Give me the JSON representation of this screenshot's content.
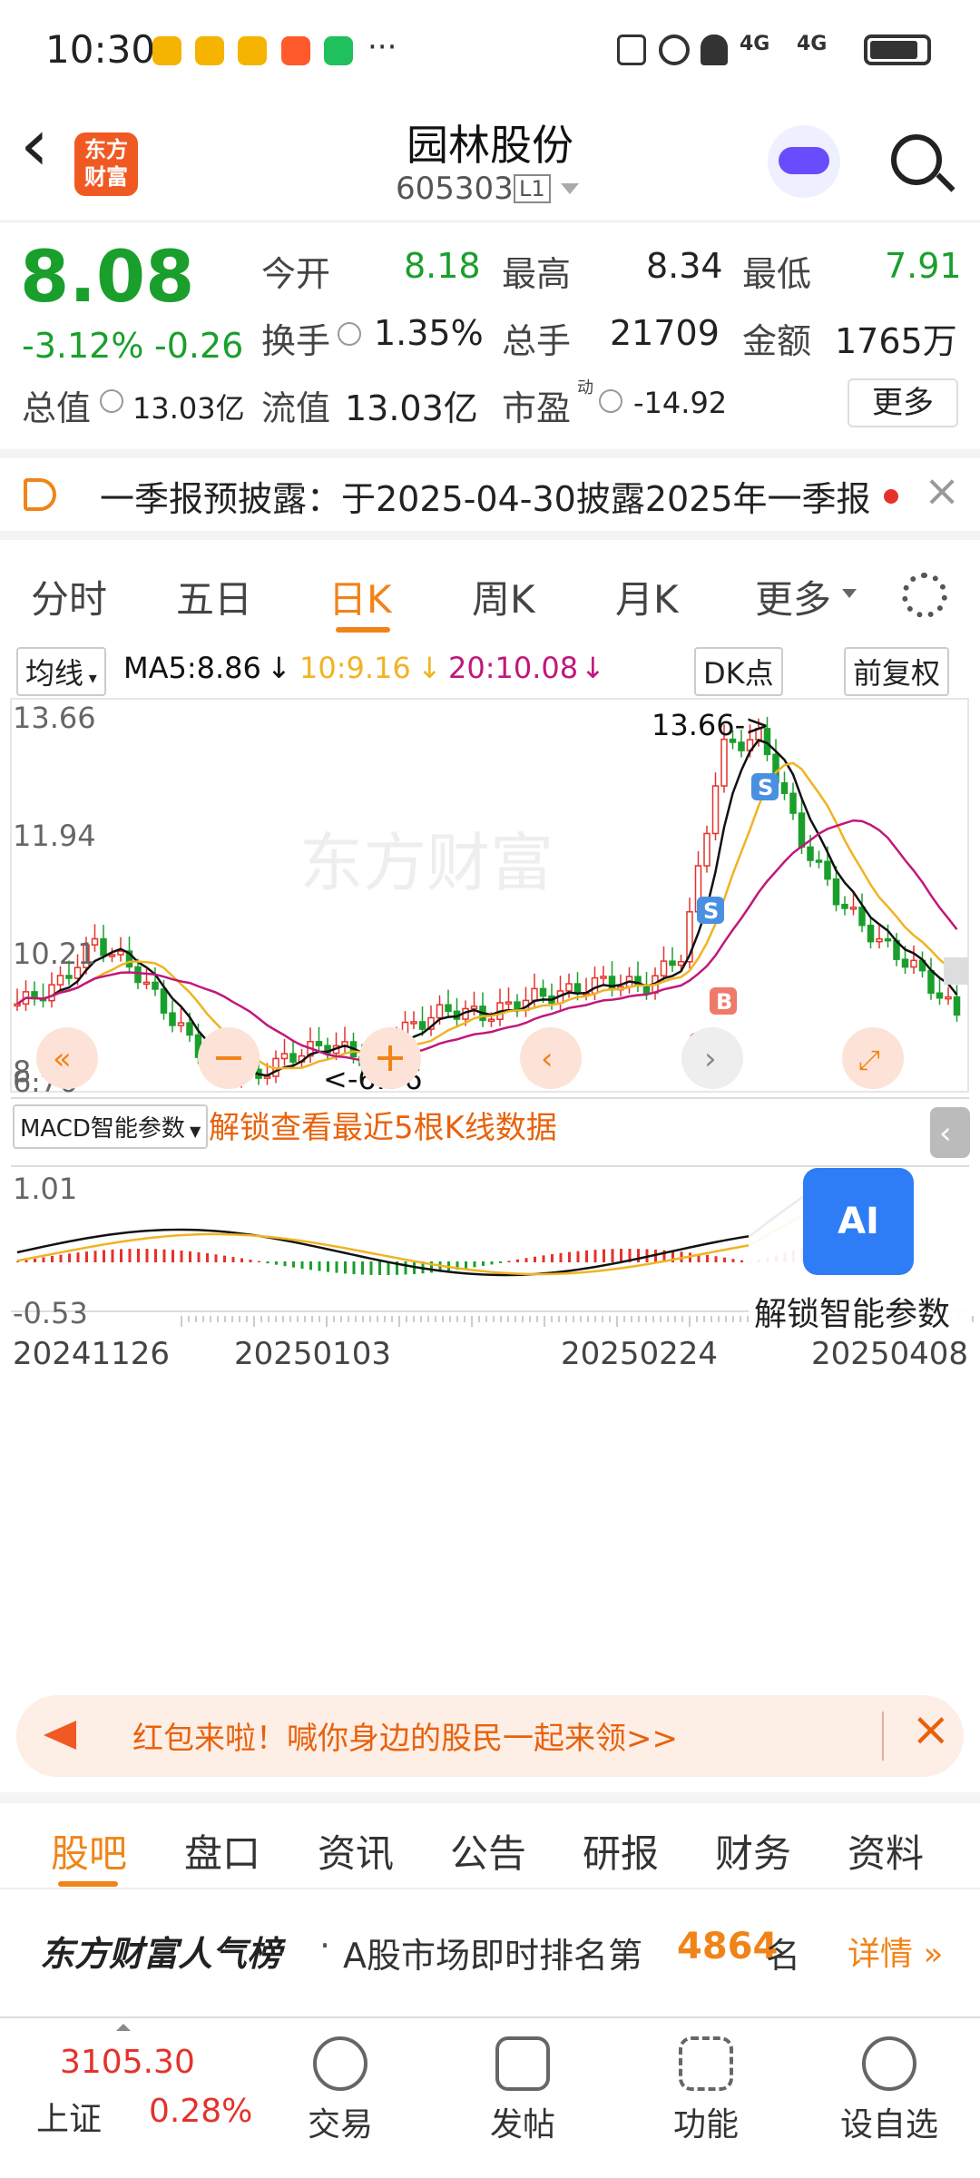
{
  "status": {
    "time": "10:30",
    "more": "···",
    "net1": "4G",
    "net2": "4G"
  },
  "header": {
    "back": "‹",
    "logo_line1": "东方",
    "logo_line2": "财富",
    "title": "园林股份",
    "code": "605303",
    "level": "L1"
  },
  "quote": {
    "price": "8.08",
    "pct": "-3.12%",
    "chg": "-0.26",
    "open_label": "今开",
    "open": "8.18",
    "high_label": "最高",
    "high": "8.34",
    "low_label": "最低",
    "low": "7.91",
    "turn_label": "换手",
    "turn": "1.35%",
    "vol_label": "总手",
    "vol": "21709",
    "amt_label": "金额",
    "amt": "1765万",
    "mcap_label": "总值",
    "mcap": "13.03亿",
    "float_label": "流值",
    "float": "13.03亿",
    "pe_label": "市盈",
    "pe_sup": "动",
    "pe": "-14.92",
    "more": "更多"
  },
  "ticker": {
    "text": "一季报预披露：于2025-04-30披露2025年一季报",
    "close": "×"
  },
  "tabs": [
    "分时",
    "五日",
    "日K",
    "周K",
    "月K",
    "更多"
  ],
  "kline": {
    "ma_btn": "均线",
    "ma5": "MA5:8.86",
    "ma10": "10:9.16",
    "ma20": "20:10.08",
    "dk_btn": "DK点",
    "fq_btn": "前复权",
    "y_labels": [
      "13.66",
      "11.94",
      "10.21",
      "8.49",
      "6.76"
    ],
    "max_note": "13.66->",
    "min_note": "<-6.76",
    "s_label": "S",
    "b_label": "B",
    "watermark": "东方财富"
  },
  "macd": {
    "btn": "MACD智能参数",
    "unlock": "解锁查看最近5根K线数据",
    "y_top": "1.01",
    "y_bot": "-0.53",
    "ai_label": "AI",
    "ai_text": "解锁智能参数",
    "dates": [
      "20241126",
      "20250103",
      "20250224",
      "20250408"
    ]
  },
  "colors": {
    "red": "#e4322b",
    "green": "#1a9f2c",
    "orange": "#f08419",
    "ma5": "#111111",
    "ma10": "#f0b323",
    "ma20": "#c0187a"
  },
  "banner": {
    "text": "红包来啦！喊你身边的股民一起来领>>",
    "close": "×"
  },
  "btabs": [
    "股吧",
    "盘口",
    "资讯",
    "公告",
    "研报",
    "财务",
    "资料"
  ],
  "rank": {
    "brand": "东方财富人气榜",
    "dot": "·",
    "text_a": "A股市场即时排名第",
    "num": "4864",
    "text_b": "名",
    "detail": "详情"
  },
  "bottom": {
    "index_val": "3105.30",
    "index_name": "上证",
    "index_pct": "0.28%",
    "items": [
      "交易",
      "发帖",
      "功能",
      "设自选"
    ]
  }
}
